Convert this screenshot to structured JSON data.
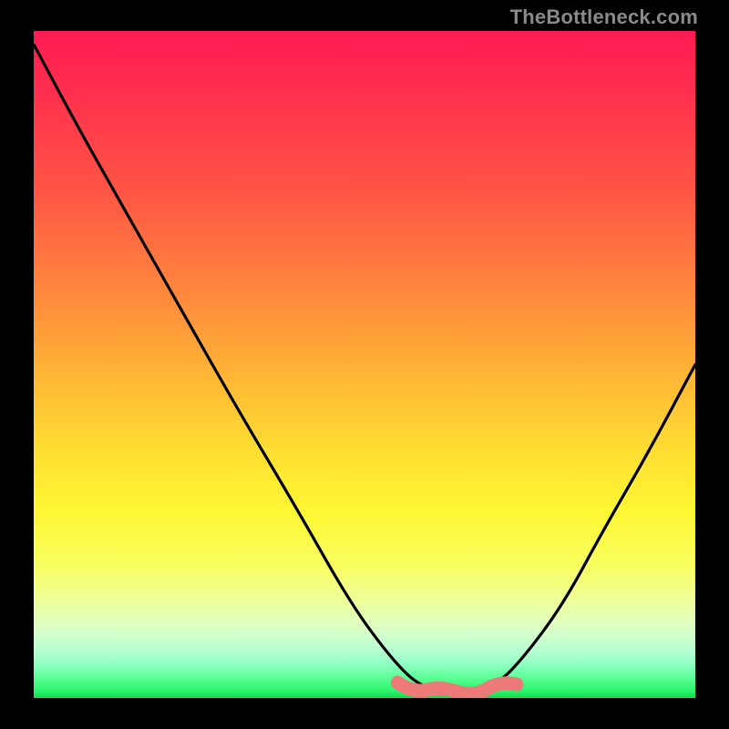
{
  "watermark": "TheBottleneck.com",
  "colors": {
    "curve": "#000000",
    "highlight": "#ed7979",
    "background": "#000000"
  },
  "chart_data": {
    "type": "line",
    "title": "",
    "xlabel": "",
    "ylabel": "",
    "xlim": [
      0,
      1
    ],
    "ylim": [
      0,
      1
    ],
    "series": [
      {
        "name": "bottleneck-curve",
        "x": [
          0.0,
          0.07,
          0.15,
          0.23,
          0.31,
          0.4,
          0.48,
          0.54,
          0.58,
          0.62,
          0.66,
          0.7,
          0.74,
          0.8,
          0.86,
          0.93,
          1.0
        ],
        "y": [
          0.98,
          0.85,
          0.71,
          0.57,
          0.43,
          0.28,
          0.14,
          0.06,
          0.02,
          0.01,
          0.01,
          0.02,
          0.06,
          0.14,
          0.25,
          0.37,
          0.5
        ]
      }
    ],
    "highlight_segment": {
      "name": "optimal-region",
      "x_range": [
        0.55,
        0.73
      ],
      "y_approx": 0.015
    }
  }
}
